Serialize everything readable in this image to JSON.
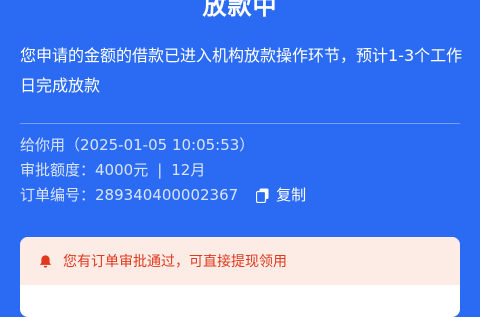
{
  "header": {
    "status_title": "放款中",
    "description": "您申请的金额的借款已进入机构放款操作环节，预计1-3个工作日完成放款"
  },
  "loan_info": {
    "lender_row": "给你用（2025-01-05 10:05:53）",
    "approval_label": "审批额度：",
    "approval_amount": "4000元",
    "separator": "|",
    "term": "12月",
    "order_label": "订单编号：",
    "order_number": "289340400002367",
    "copy_label": "复制",
    "copy_icon": "copy-icon"
  },
  "notice": {
    "icon": "bell-icon",
    "text": "您有订单审批通过，可直接提现领用"
  },
  "colors": {
    "background": "#2B6BF3",
    "notice_bg": "#FDEBE5",
    "notice_text": "#E0391E"
  }
}
